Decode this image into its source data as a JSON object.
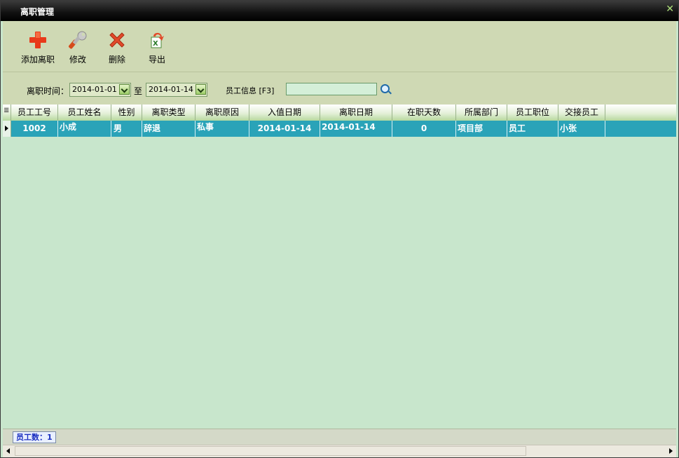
{
  "window": {
    "title": "离职管理"
  },
  "toolbar": {
    "buttons": [
      {
        "label": "添加离职",
        "icon": "plus-icon"
      },
      {
        "label": "修改",
        "icon": "wrench-icon"
      },
      {
        "label": "删除",
        "icon": "delete-x-icon"
      },
      {
        "label": "导出",
        "icon": "export-excel-icon"
      }
    ]
  },
  "filter": {
    "date_label": "离职时间：",
    "from": "2014-01-01",
    "to_label": "至",
    "to": "2014-01-14",
    "info_label": "员工信息 [F3]",
    "info_value": ""
  },
  "grid": {
    "columns": [
      "员工工号",
      "员工姓名",
      "性别",
      "离职类型",
      "离职原因",
      "入值日期",
      "离职日期",
      "在职天数",
      "所属部门",
      "员工职位",
      "交接员工"
    ],
    "rows": [
      [
        "1002",
        "小成",
        "男",
        "辞退",
        "私事",
        "2014-01-14",
        "2014-01-14",
        "0",
        "项目部",
        "员工",
        "小张"
      ]
    ]
  },
  "status": {
    "count_text": "员工数：1"
  },
  "colors": {
    "selected_row": "#2aa3b8",
    "background": "#c8e6cc",
    "toolbar": "#cfd9b4"
  }
}
